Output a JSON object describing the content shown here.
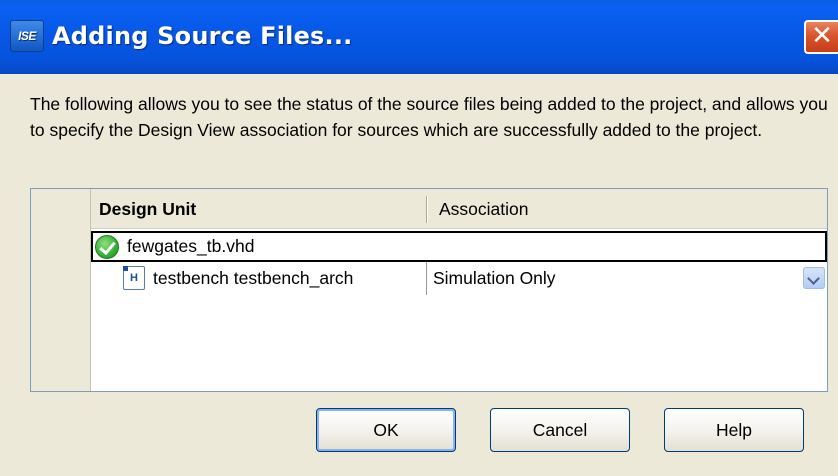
{
  "window": {
    "title": "Adding Source Files...",
    "app_icon_text": "ISE",
    "close_glyph": "✕"
  },
  "description": "The following allows you to see the status of the source files being added to the project, and allows you to specify the Design View association for sources which are successfully added to the project.",
  "grid": {
    "columns": [
      "Design Unit",
      "Association"
    ],
    "file": {
      "status_icon": "success-check-icon",
      "name": "fewgates_tb.vhd"
    },
    "units": [
      {
        "icon": "vhdl-file-icon",
        "icon_text": "H",
        "name": "testbench testbench_arch",
        "association": "Simulation Only"
      }
    ]
  },
  "buttons": {
    "ok": "OK",
    "cancel": "Cancel",
    "help": "Help"
  },
  "colors": {
    "titlebar": "#0758e7",
    "close_button": "#d9552e",
    "dialog_bg": "#ece9d8",
    "success_green": "#3ab43a"
  }
}
